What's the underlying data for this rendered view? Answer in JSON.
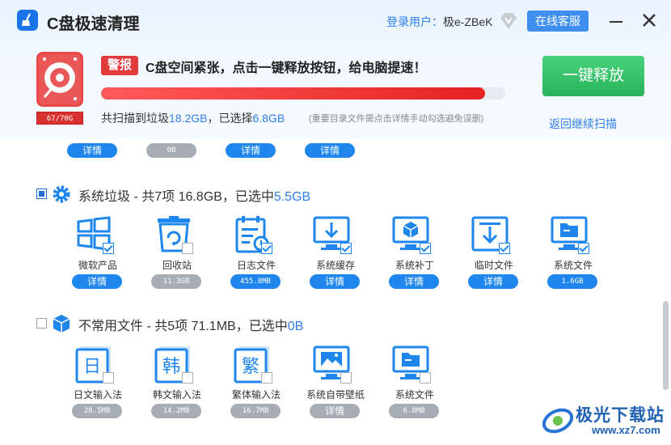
{
  "titlebar": {
    "app_title": "C盘极速清理",
    "login_label": "登录用户：",
    "username": "极e-ZBeK",
    "support_label": "在线客服"
  },
  "alert": {
    "badge": "警报",
    "message": "C盘空间紧张，点击一键释放按钮，给电脑提速！",
    "disk_usage": "67/70G",
    "progress_fraction": 0.95,
    "summary_prefix": "共扫描到垃圾",
    "total_size": "18.2GB",
    "summary_mid": "，已选择",
    "selected_size": "6.8GB",
    "note": "(重要目录文件需点击详情手动勾选避免误删)",
    "release_label": "一键释放",
    "rescan_label": "返回继续扫描"
  },
  "top_row_pills": [
    "详情",
    "0B",
    "详情",
    "详情"
  ],
  "sections": [
    {
      "title_prefix": "系统垃圾 - 共7项 16.8GB，已选中",
      "selected": "5.5GB",
      "checked": true,
      "items": [
        {
          "label": "微软产品",
          "pill": "详情",
          "pill_style": "blue",
          "checked": true,
          "icon": "windows-icon"
        },
        {
          "label": "回收站",
          "pill": "11.3GB",
          "pill_style": "grey",
          "checked": false,
          "icon": "recycle-bin-icon"
        },
        {
          "label": "日志文件",
          "pill": "455.8MB",
          "pill_style": "blue-mono",
          "checked": true,
          "icon": "log-file-icon"
        },
        {
          "label": "系统缓存",
          "pill": "详情",
          "pill_style": "blue",
          "checked": true,
          "icon": "system-cache-icon"
        },
        {
          "label": "系统补丁",
          "pill": "详情",
          "pill_style": "blue",
          "checked": true,
          "icon": "system-patch-icon"
        },
        {
          "label": "临时文件",
          "pill": "详情",
          "pill_style": "blue",
          "checked": true,
          "icon": "temp-file-icon"
        },
        {
          "label": "系统文件",
          "pill": "1.6GB",
          "pill_style": "blue-mono",
          "checked": true,
          "icon": "system-file-icon"
        }
      ]
    },
    {
      "title_prefix": "不常用文件 - 共5项 71.1MB，已选中",
      "selected": "0B",
      "checked": false,
      "items": [
        {
          "label": "日文输入法",
          "pill": "28.5MB",
          "pill_style": "grey",
          "checked": false,
          "icon": "japanese-ime-icon",
          "glyph": "日"
        },
        {
          "label": "韩文输入法",
          "pill": "14.2MB",
          "pill_style": "grey",
          "checked": false,
          "icon": "korean-ime-icon",
          "glyph": "韩"
        },
        {
          "label": "繁体输入法",
          "pill": "16.7MB",
          "pill_style": "grey",
          "checked": false,
          "icon": "traditional-ime-icon",
          "glyph": "繁"
        },
        {
          "label": "系统自带壁纸",
          "pill": "详情",
          "pill_style": "grey-text",
          "checked": false,
          "icon": "wallpaper-icon"
        },
        {
          "label": "系统文件",
          "pill": "6.8MB",
          "pill_style": "grey",
          "checked": false,
          "icon": "system-file-icon"
        }
      ]
    }
  ],
  "watermark": {
    "text": "极光下载站",
    "url": "www.xz7.com"
  },
  "colors": {
    "accent": "#2d7ff0",
    "danger": "#e23b3b",
    "success": "#28b35c",
    "icon_blue": "#1f86ee"
  }
}
